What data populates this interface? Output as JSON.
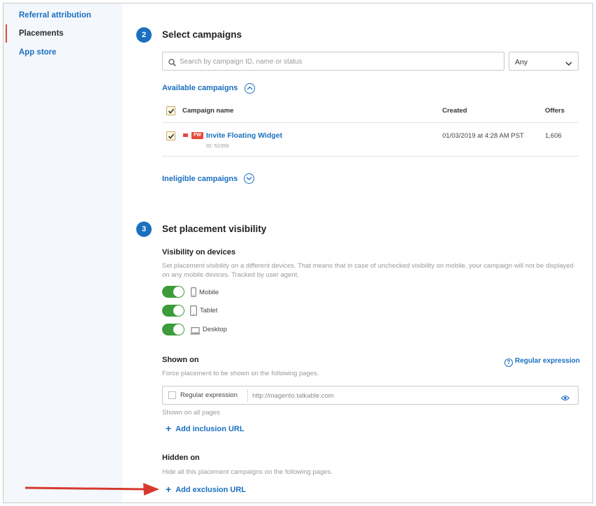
{
  "sidebar": {
    "items": [
      {
        "label": "Referral attribution",
        "active": false
      },
      {
        "label": "Placements",
        "active": true
      },
      {
        "label": "App store",
        "active": false
      }
    ]
  },
  "step2": {
    "number": "2",
    "title": "Select campaigns",
    "search_placeholder": "Search by campaign ID, name or status",
    "filter_value": "Any",
    "available_label": "Available campaigns",
    "ineligible_label": "Ineligible campaigns",
    "table": {
      "headers": {
        "name": "Campaign name",
        "created": "Created",
        "offers": "Offers"
      },
      "rows": [
        {
          "badge": "FW",
          "name": "Invite Floating Widget",
          "id": "ID: 52359",
          "created": "01/03/2019 at 4:28 AM PST",
          "offers": "1,606",
          "checked": true
        }
      ]
    }
  },
  "step3": {
    "number": "3",
    "title": "Set placement visibility",
    "devices_heading": "Visibility on devices",
    "devices_help": "Set placement visibility on a different devices. That means that in case of unchecked visibility on mobile, your campaign will not be displayed on any mobile devices. Tracked by user agent.",
    "devices": [
      {
        "label": "Mobile",
        "icon": "mobile-icon",
        "enabled": true
      },
      {
        "label": "Tablet",
        "icon": "tablet-icon",
        "enabled": true
      },
      {
        "label": "Desktop",
        "icon": "desktop-icon",
        "enabled": true
      }
    ],
    "shown_on": {
      "heading": "Shown on",
      "help": "Force placement to be shown on the following pages.",
      "regex_link": "Regular expression",
      "row_checkbox_label": "Regular expression",
      "url_placeholder": "http://magento.talkable.com",
      "note": "Shown on all pages",
      "add_label": "Add inclusion URL"
    },
    "hidden_on": {
      "heading": "Hidden on",
      "help": "Hide all this placement campaigns on the following pages.",
      "add_label": "Add exclusion URL"
    }
  },
  "colors": {
    "accent": "#1a6fc0",
    "toggle_on": "#3c9b3a",
    "badge": "#e44a3a",
    "annotation_arrow": "#d63a2e"
  }
}
